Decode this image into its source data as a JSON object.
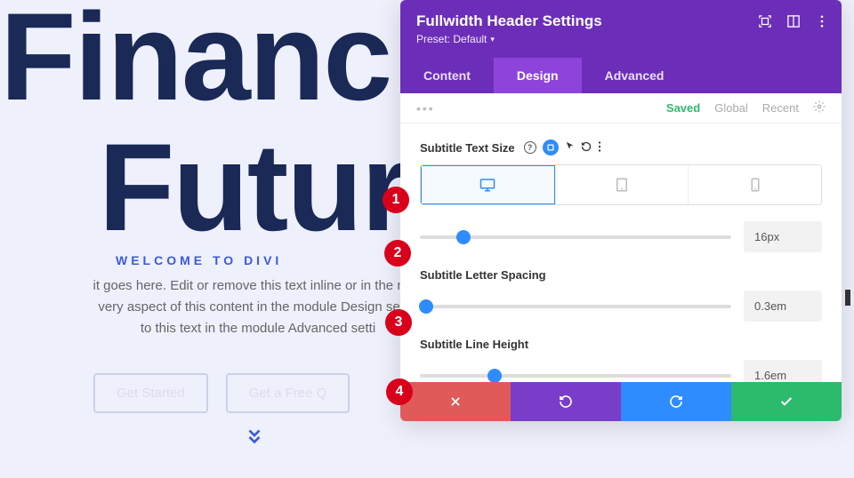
{
  "hero": {
    "title_line1": "Financ",
    "title_line2": "Future",
    "subtitle": "Welcome to Divi",
    "body": "it goes here. Edit or remove this text inline or in the modvery aspect of this content in the module Design settin to this text in the module Advanced setti",
    "body_lines": [
      "it goes here. Edit or remove this text inline or in the mod",
      "very aspect of this content in the module Design settin",
      "to this text in the module Advanced setti"
    ],
    "cta1": "Get Started",
    "cta2": "Get a Free Q"
  },
  "annotations": {
    "a1": "1",
    "a2": "2",
    "a3": "3",
    "a4": "4"
  },
  "panel": {
    "title": "Fullwidth Header Settings",
    "preset_label": "Preset: Default",
    "tabs": {
      "content": "Content",
      "design": "Design",
      "advanced": "Advanced",
      "active": "design"
    },
    "subrow": {
      "saved": "Saved",
      "global": "Global",
      "recent": "Recent"
    },
    "fields": {
      "text_size": {
        "label": "Subtitle Text Size",
        "value": "16px",
        "slider_pct": 14
      },
      "letter_spacing": {
        "label": "Subtitle Letter Spacing",
        "value": "0.3em",
        "slider_pct": 2
      },
      "line_height": {
        "label": "Subtitle Line Height",
        "value": "1.6em",
        "slider_pct": 24
      }
    }
  }
}
